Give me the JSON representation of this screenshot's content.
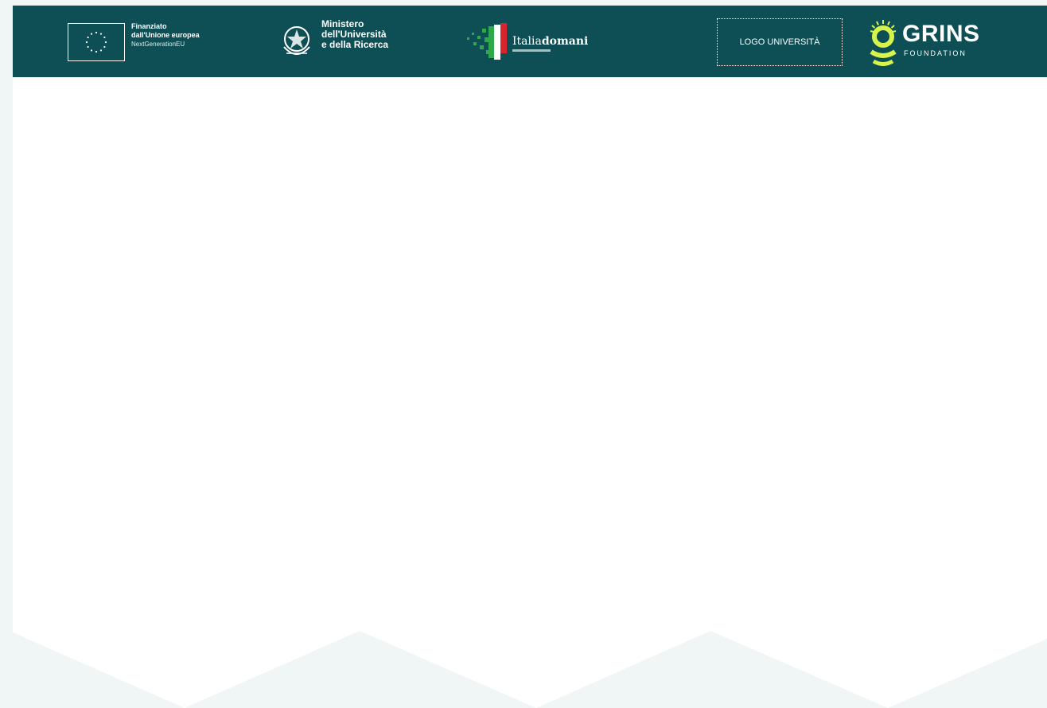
{
  "header": {
    "background": "#0d4f55",
    "accent": "#d8f34a",
    "eu": {
      "line1": "Finanziato",
      "line2": "dall'Unione europea",
      "line3": "NextGenerationEU"
    },
    "ministry": {
      "line1": "Ministero",
      "line2": "dell'Università",
      "line3": "e della Ricerca"
    },
    "italia_domani": {
      "word_light": "Italia",
      "word_bold": "domani"
    },
    "university_logo_placeholder": "LOGO UNIVERSITÀ",
    "grins": {
      "title": "GRINS",
      "subtitle": "FOUNDATION"
    }
  },
  "colors": {
    "page_bg": "#f0f6f6",
    "content_bg": "#ffffff"
  }
}
